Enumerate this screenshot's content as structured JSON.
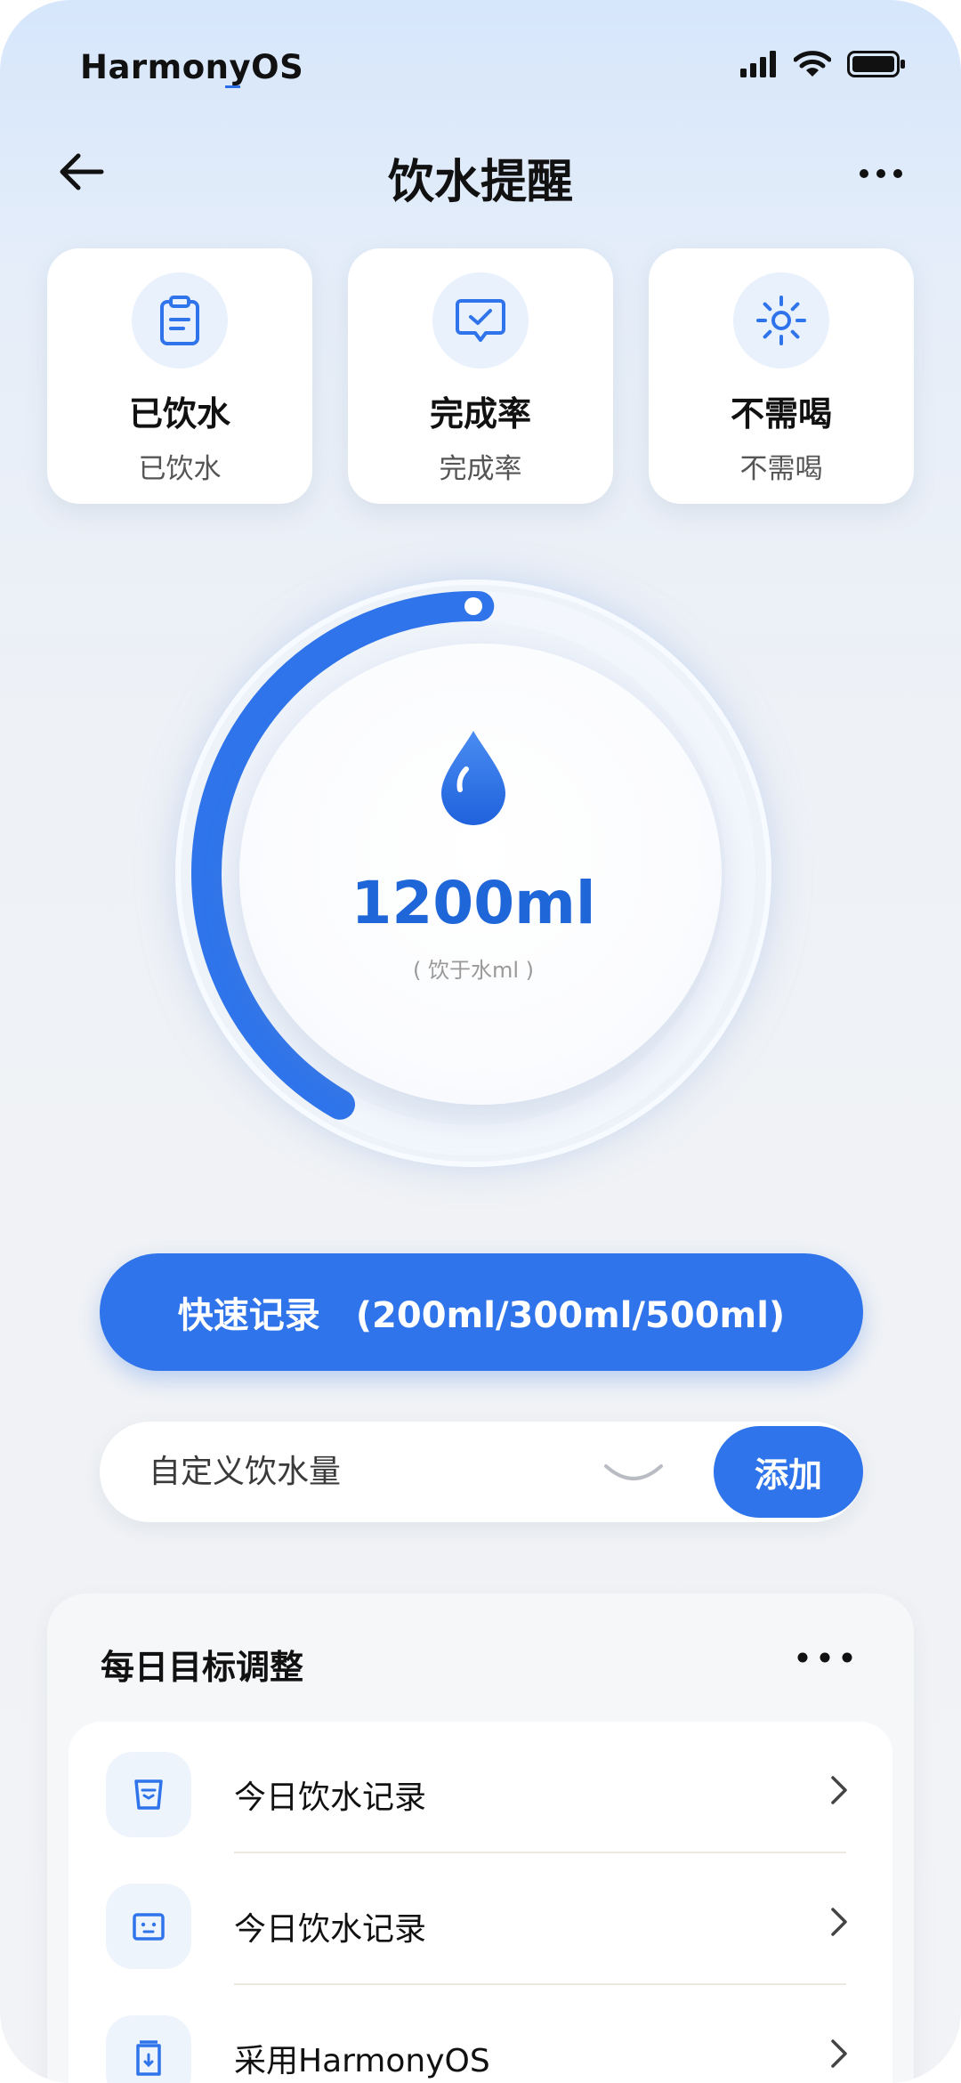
{
  "status_bar": {
    "os_name": "HarmonyOS",
    "icons": [
      "signal-icon",
      "wifi-icon",
      "battery-icon"
    ]
  },
  "header": {
    "title": "饮水提醒",
    "back_icon": "arrow-left-icon",
    "more_icon": "more-horizontal-icon"
  },
  "stat_cards": [
    {
      "title": "已饮水",
      "subtitle": "已饮水",
      "icon": "clipboard-icon"
    },
    {
      "title": "完成率",
      "subtitle": "完成率",
      "icon": "chat-check-icon"
    },
    {
      "title": "不需喝",
      "subtitle": "不需喝",
      "icon": "sun-icon"
    }
  ],
  "progress": {
    "value": "1200ml",
    "caption": "( 饮于水ml )",
    "fraction": 0.42,
    "accent": "#2f74ea"
  },
  "quick_record": {
    "label": "快速记录　(200ml/300ml/500ml)"
  },
  "custom": {
    "placeholder": "自定义饮水量",
    "add_label": "添加"
  },
  "goal": {
    "title": "每日目标调整",
    "items": [
      {
        "label": "今日饮水记录",
        "icon": "cup-icon"
      },
      {
        "label": "今日饮水记录",
        "icon": "glass-icon"
      },
      {
        "label": "采用HarmonyOS",
        "icon": "bottle-icon"
      }
    ]
  },
  "colors": {
    "primary": "#2f74ea",
    "text": "#111111",
    "muted": "#555555"
  }
}
